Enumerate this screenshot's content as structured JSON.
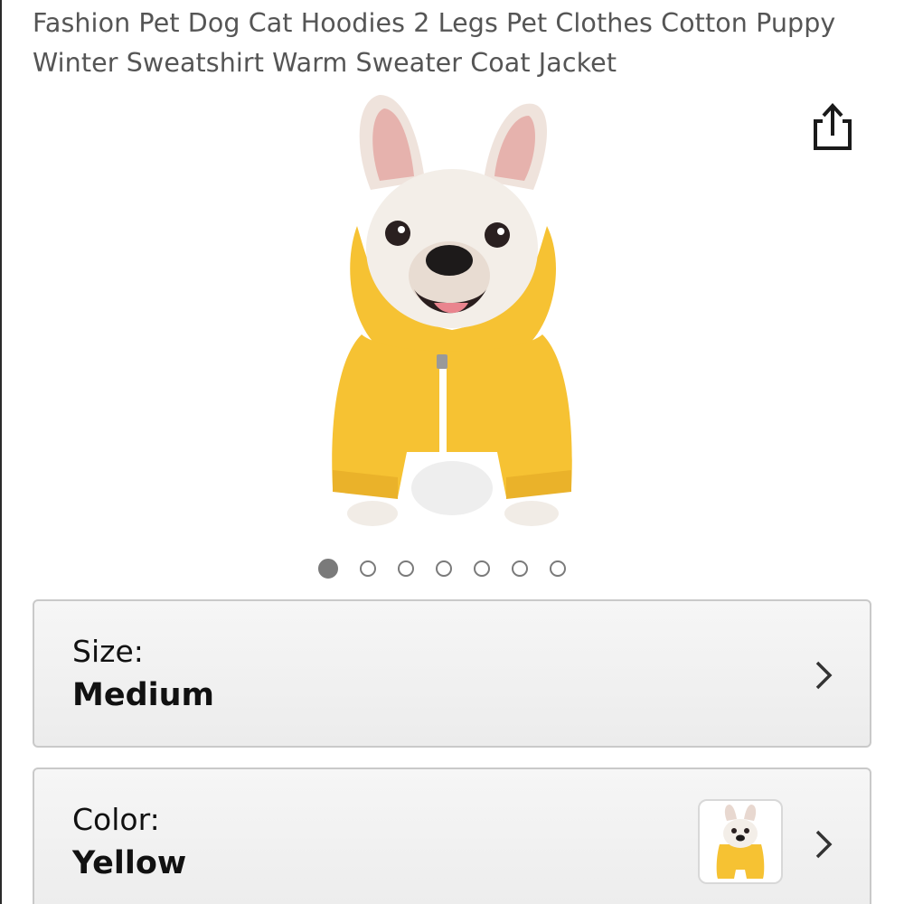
{
  "product": {
    "title": "Fashion Pet Dog Cat Hoodies 2 Legs Pet Clothes Cotton Puppy Winter Sweatshirt Warm Sweater Coat Jacket",
    "image_icon": "dog-in-yellow-hoodie-image"
  },
  "toolbar": {
    "share_icon": "share-icon"
  },
  "carousel": {
    "total": 7,
    "active_index": 1
  },
  "options": {
    "size": {
      "label": "Size:",
      "value": "Medium"
    },
    "color": {
      "label": "Color:",
      "value": "Yellow",
      "swatch_icon": "yellow-hoodie-swatch"
    }
  },
  "colors": {
    "hoodie": "#f6c233",
    "card_border": "#c9c9c9",
    "dot": "#7a7a7a"
  }
}
